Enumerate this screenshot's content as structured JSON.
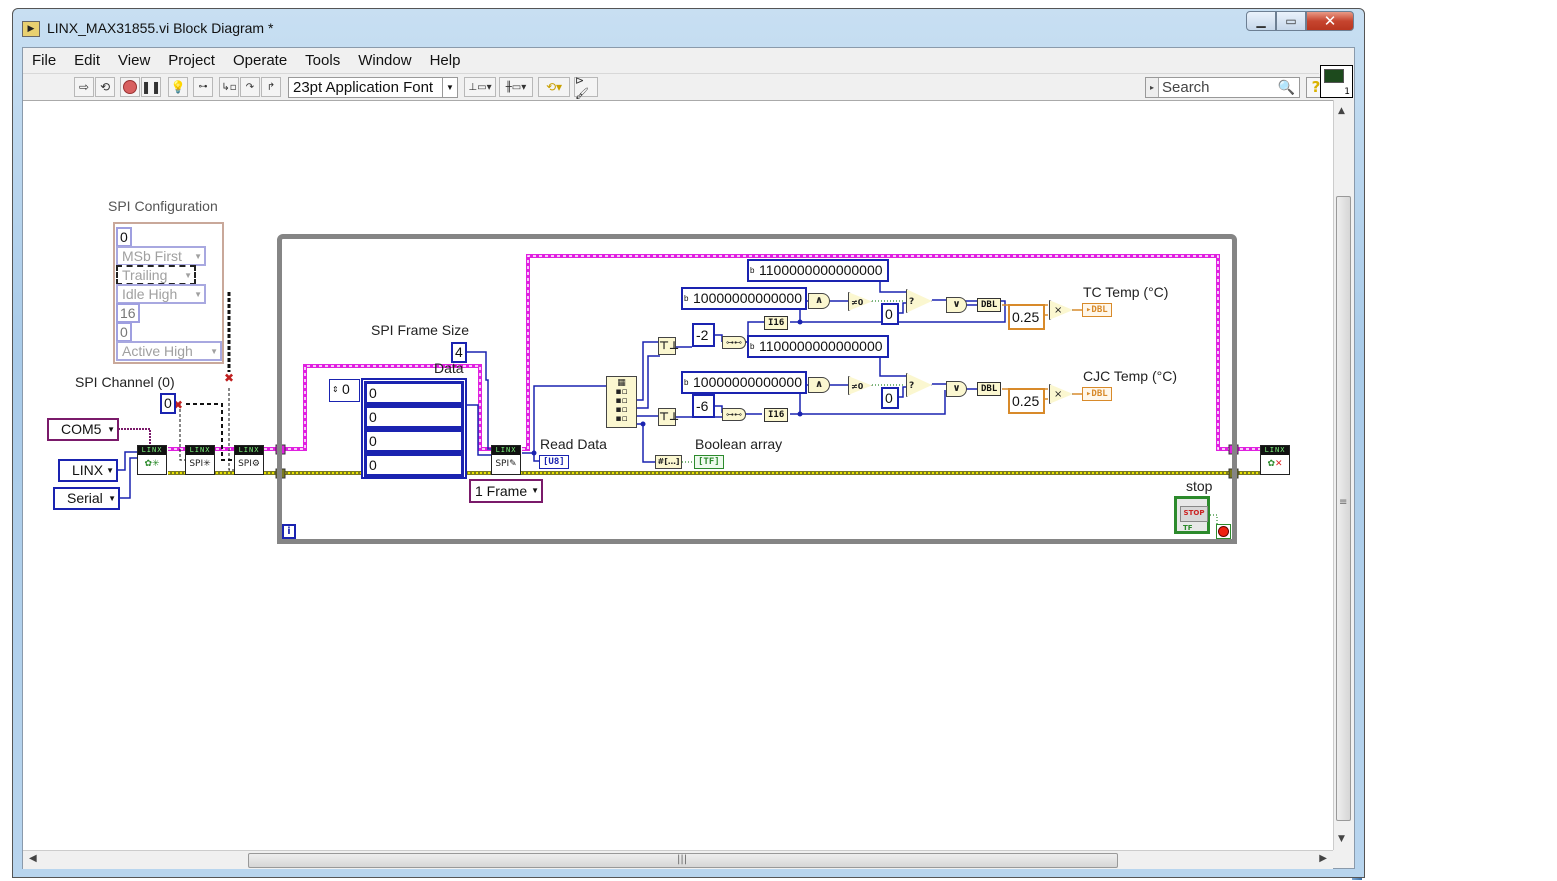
{
  "window": {
    "title": "LINX_MAX31855.vi Block Diagram *",
    "controls": {
      "minimize": "minimize",
      "maximize": "maximize",
      "close": "close"
    }
  },
  "menubar": {
    "items": [
      {
        "label": "File",
        "accel": "F"
      },
      {
        "label": "Edit",
        "accel": "E"
      },
      {
        "label": "View",
        "accel": "V"
      },
      {
        "label": "Project",
        "accel": "P"
      },
      {
        "label": "Operate",
        "accel": "O"
      },
      {
        "label": "Tools",
        "accel": "T"
      },
      {
        "label": "Window",
        "accel": "W"
      },
      {
        "label": "Help",
        "accel": "H"
      }
    ]
  },
  "toolbar": {
    "buttons": [
      "run",
      "run-continuously",
      "abort",
      "pause",
      "highlight-execution",
      "retain-wire-values",
      "step-into",
      "step-over",
      "step-out"
    ],
    "font_select": "23pt Application Font",
    "layout_buttons": [
      "align-objects",
      "distribute-objects",
      "reorder",
      "clean-up-diagram"
    ],
    "search_placeholder": "Search",
    "help_label": "?",
    "vi_icon_number": "1"
  },
  "diagram": {
    "spi_config": {
      "label": "SPI Configuration",
      "fields": [
        "0",
        "MSb First",
        "Trailing",
        "Idle High",
        "16",
        "0",
        "Active High"
      ]
    },
    "spi_channel": {
      "label": "SPI Channel (0)",
      "value": "0"
    },
    "com_port": "COM5",
    "linx_type": "LINX",
    "connection": "Serial",
    "frame_size": {
      "label": "SPI Frame Size",
      "value": "4"
    },
    "data_array": {
      "label": "Data",
      "index": "0",
      "values": [
        "0",
        "0",
        "0",
        "0"
      ]
    },
    "frame_mode": "1 Frame",
    "read_data": {
      "label": "Read Data",
      "type": "U8"
    },
    "boolean_array": {
      "label": "Boolean array",
      "type": "TF"
    },
    "masks": {
      "upper_sign": "1100000000000000",
      "upper_and": "10000000000000",
      "lower_sign": "1100000000000000",
      "lower_and": "10000000000000"
    },
    "shift_upper": "-2",
    "shift_lower": "-6",
    "zero_upper": "0",
    "zero_lower": "0",
    "cast_type": "I16",
    "convert_type": "DBL",
    "scale_tc": "0.25",
    "scale_cjc": "0.25",
    "tc_temp": {
      "label": "TC Temp (°C)",
      "type": "DBL"
    },
    "cjc_temp": {
      "label": "CJC Temp (°C)",
      "type": "DBL"
    },
    "stop": {
      "label": "stop",
      "button_text": "STOP",
      "type": "TF"
    },
    "iteration": "i",
    "linx_header": "LINX",
    "spi_text": "SPI",
    "and_glyph": "∧",
    "or_glyph": "∨",
    "notzero_glyph": "≠0",
    "multiply_glyph": "×",
    "select_glyph": "?"
  }
}
